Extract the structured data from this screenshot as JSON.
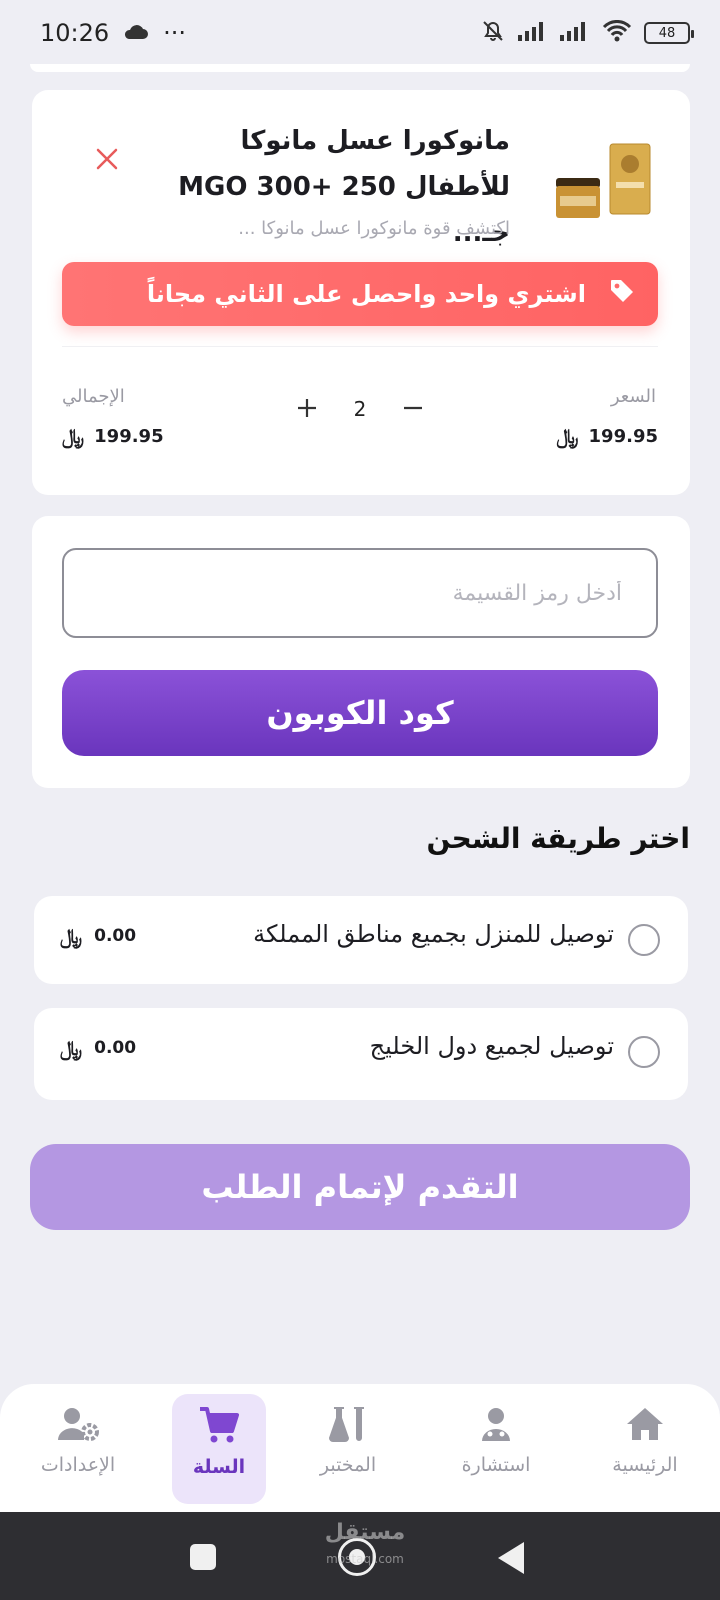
{
  "status_bar": {
    "time": "10:26",
    "more": "···",
    "battery": "48"
  },
  "cart_item": {
    "title": "مانوكورا عسل مانوكا للأطفال 250 +MGO 300 جـ...",
    "subtitle": "اكتشف قوة مانوكورا عسل مانوكا ...",
    "promo_text": "اشتري واحد واحصل على الثاني مجاناً",
    "price_label": "السعر",
    "price_value": "199.95",
    "total_label": "الإجمالي",
    "total_value": "199.95",
    "quantity": "2",
    "currency_symbol": "﷼",
    "icons": [
      "close-icon",
      "tag-icon",
      "minus-icon",
      "plus-icon"
    ]
  },
  "coupon": {
    "placeholder": "أدخل رمز القسيمة",
    "value": "",
    "button_label": "كود الكوبون"
  },
  "shipping": {
    "title": "اختر طريقة الشحن",
    "options": [
      {
        "label": "توصيل للمنزل بجميع مناطق المملكة",
        "price": "0.00"
      },
      {
        "label": "توصيل لجميع دول الخليج",
        "price": "0.00"
      }
    ]
  },
  "checkout": {
    "button_label": "التقدم لإتمام الطلب"
  },
  "bottom_nav": {
    "items": [
      {
        "label": "الرئيسية",
        "icon": "home-icon"
      },
      {
        "label": "استشارة",
        "icon": "doctor-icon"
      },
      {
        "label": "المختبر",
        "icon": "flask-icon"
      },
      {
        "label": "السلة",
        "icon": "cart-icon",
        "active": true
      },
      {
        "label": "الإعدادات",
        "icon": "user-settings-icon"
      }
    ]
  },
  "watermark": {
    "text": "مستقل",
    "sub": "mostaql.com"
  },
  "colors": {
    "accent_purple": "#6a35bd",
    "promo_red": "#ff6b6b",
    "checkout_disabled": "#b497e2",
    "background": "#eeeef4"
  }
}
